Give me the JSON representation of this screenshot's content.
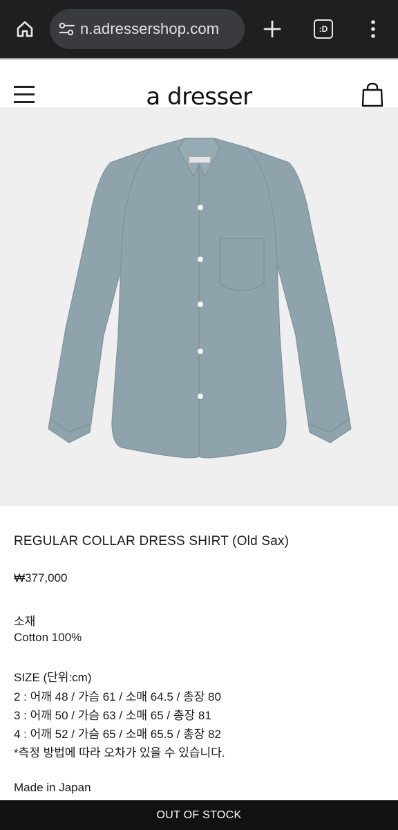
{
  "browser": {
    "url_text": "n.adressershop.com",
    "tab_count": ":D"
  },
  "site": {
    "brand": "a dresser"
  },
  "product": {
    "title": "REGULAR COLLAR DRESS SHIRT (Old Sax)",
    "price": "₩377,000",
    "material_label": "소재",
    "material_value": "Cotton 100%",
    "size_header": "SIZE (단위:cm)",
    "sizes": [
      "2 : 어깨 48 / 가슴 61 / 소매 64.5 / 총장 80",
      "3 : 어깨 50 / 가슴 63 / 소매 65 / 총장 81",
      "4 : 어깨 52 / 가슴 65 / 소매 65.5 / 총장 82"
    ],
    "note": "*측정 방법에 따라 오차가 있을 수 있습니다.",
    "origin": "Made in Japan",
    "shirt_color": "#8ea3ac"
  },
  "cta": {
    "label": "OUT OF STOCK"
  }
}
